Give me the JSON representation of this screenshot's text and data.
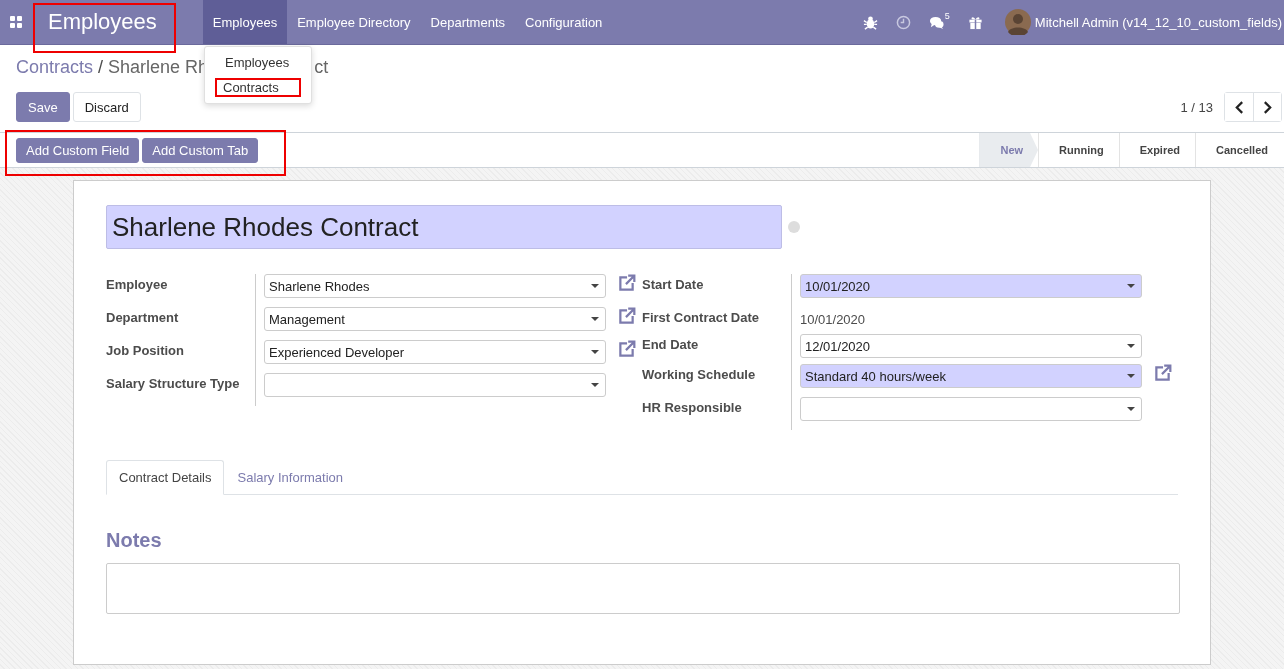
{
  "navbar": {
    "app_title": {
      "text": "Employees",
      "highlighted": true
    },
    "menu": [
      {
        "label": "Employees",
        "selected": true
      },
      {
        "label": "Employee Directory",
        "selected": false
      },
      {
        "label": "Departments",
        "selected": false
      },
      {
        "label": "Configuration",
        "selected": false
      }
    ],
    "icons": [
      {
        "kind": "bug"
      },
      {
        "kind": "clock"
      },
      {
        "kind": "chat",
        "badge": "5"
      },
      {
        "kind": "gift"
      }
    ],
    "user": "Mitchell Admin (v14_12_10_custom_fields)"
  },
  "menu_dropdown": {
    "items": [
      {
        "label": "Employees",
        "highlighted": false
      },
      {
        "label": "Contracts",
        "highlighted": true
      }
    ]
  },
  "breadcrumb": {
    "parent": "Contracts",
    "separator": "/",
    "current_parts": [
      "Sharlene Rh",
      "ct"
    ]
  },
  "buttons": [
    {
      "label": "Save",
      "primary": true
    },
    {
      "label": "Discard",
      "primary": false
    }
  ],
  "pager": {
    "text": "1 / 13"
  },
  "custom_toolbar": {
    "highlighted": true,
    "buttons": [
      "Add Custom Field",
      "Add Custom Tab"
    ]
  },
  "statusbar": [
    {
      "label": "New",
      "selected": true
    },
    {
      "label": "Running",
      "selected": false
    },
    {
      "label": "Expired",
      "selected": false
    },
    {
      "label": "Cancelled",
      "selected": false
    }
  ],
  "form": {
    "title": "Sharlene Rhodes Contract",
    "left": [
      {
        "label": "Employee",
        "value": "Sharlene Rhodes",
        "kind": "select",
        "required": false,
        "external_link": true
      },
      {
        "label": "Department",
        "value": "Management",
        "kind": "select",
        "required": false,
        "external_link": true
      },
      {
        "label": "Job Position",
        "value": "Experienced Developer",
        "kind": "select",
        "required": false,
        "external_link": true
      },
      {
        "label": "Salary Structure Type",
        "kind": "select",
        "required": false,
        "external_link": false
      }
    ],
    "right": [
      {
        "label": "Start Date",
        "value": "10/01/2020",
        "kind": "select",
        "required": true,
        "external_link": false
      },
      {
        "label": "First Contract Date",
        "value": "10/01/2020",
        "kind": "readonly"
      },
      {
        "label": "End Date",
        "value": "12/01/2020",
        "kind": "select",
        "required": false,
        "external_link": false
      },
      {
        "label": "Working Schedule",
        "value": "Standard 40 hours/week",
        "kind": "select",
        "required": true,
        "external_link": true
      },
      {
        "label": "HR Responsible",
        "kind": "select",
        "required": false,
        "external_link": false
      }
    ]
  },
  "tabs": [
    {
      "label": "Contract Details",
      "selected": true
    },
    {
      "label": "Salary Information",
      "selected": false
    }
  ],
  "notes": {
    "heading": "Notes"
  }
}
